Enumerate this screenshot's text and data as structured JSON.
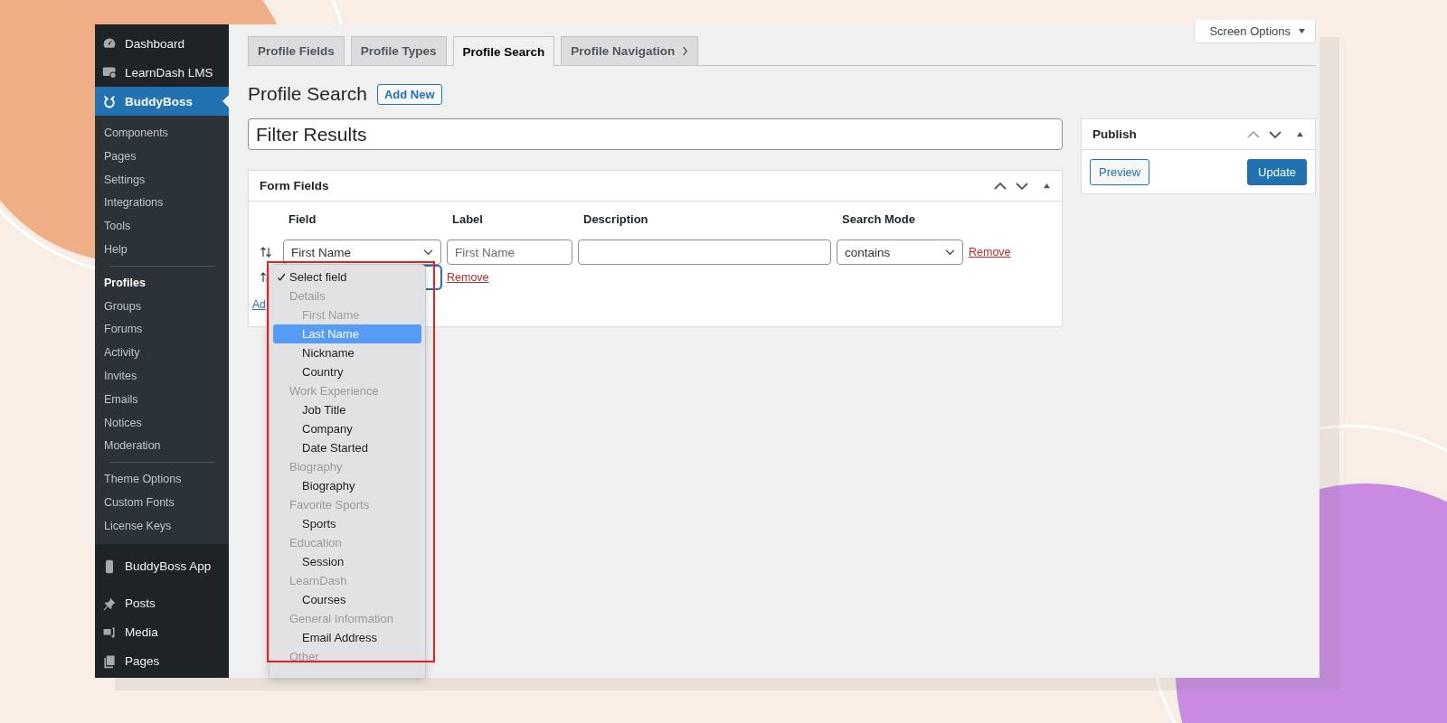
{
  "sidebar": {
    "sections": [
      {
        "items": [
          {
            "label": "Dashboard",
            "selected": false
          },
          {
            "label": "LearnDash LMS",
            "selected": false
          },
          {
            "label": "BuddyBoss",
            "selected": true,
            "submenu": [
              {
                "items": [
                  {
                    "label": "Components",
                    "selected": false
                  },
                  {
                    "label": "Pages",
                    "selected": false
                  },
                  {
                    "label": "Settings",
                    "selected": false
                  },
                  {
                    "label": "Integrations",
                    "selected": false
                  },
                  {
                    "label": "Tools",
                    "selected": false
                  },
                  {
                    "label": "Help",
                    "selected": false
                  }
                ]
              },
              {
                "items": [
                  {
                    "label": "Profiles",
                    "selected": true
                  },
                  {
                    "label": "Groups",
                    "selected": false
                  },
                  {
                    "label": "Forums",
                    "selected": false
                  },
                  {
                    "label": "Activity",
                    "selected": false
                  },
                  {
                    "label": "Invites",
                    "selected": false
                  },
                  {
                    "label": "Emails",
                    "selected": false
                  },
                  {
                    "label": "Notices",
                    "selected": false
                  },
                  {
                    "label": "Moderation",
                    "selected": false
                  }
                ]
              },
              {
                "items": [
                  {
                    "label": "Theme Options",
                    "selected": false
                  },
                  {
                    "label": "Custom Fonts",
                    "selected": false
                  },
                  {
                    "label": "License Keys",
                    "selected": false
                  }
                ]
              }
            ]
          }
        ]
      },
      {
        "items": [
          {
            "label": "BuddyBoss App",
            "selected": false
          }
        ]
      },
      {
        "items": [
          {
            "label": "Posts",
            "selected": false
          },
          {
            "label": "Media",
            "selected": false
          },
          {
            "label": "Pages",
            "selected": false
          }
        ]
      }
    ]
  },
  "screen_options": "Screen Options",
  "tabs": [
    {
      "label": "Profile Fields",
      "kind": "tab",
      "selected": false
    },
    {
      "label": "Profile Types",
      "kind": "tab",
      "selected": false
    },
    {
      "label": "Profile Search",
      "kind": "tab",
      "selected": true
    },
    {
      "label": "Profile Navigation",
      "kind": "menu",
      "selected": false
    }
  ],
  "heading": "Profile Search",
  "add_new": "Add New",
  "title_value": "Filter Results",
  "form_fields": {
    "title": "Form Fields",
    "columns": [
      "Field",
      "Label",
      "Description",
      "Search Mode"
    ],
    "rows": [
      {
        "field": "First Name",
        "label_placeholder": "First Name",
        "search_mode": "contains",
        "remove": "Remove"
      },
      {
        "field_focused": true,
        "remove": "Remove"
      }
    ],
    "add_link": "Ad"
  },
  "publish": {
    "title": "Publish",
    "preview": "Preview",
    "update": "Update"
  },
  "dropdown": {
    "items": [
      {
        "kind": "option",
        "label": "Select field",
        "checked": true,
        "selected": false,
        "disabled": false
      },
      {
        "kind": "group",
        "label": "Details",
        "children": [
          {
            "label": "First Name",
            "checked": false,
            "selected": false,
            "disabled": true
          },
          {
            "label": "Last Name",
            "checked": false,
            "selected": true,
            "disabled": false
          },
          {
            "label": "Nickname",
            "checked": false,
            "selected": false,
            "disabled": false
          },
          {
            "label": "Country",
            "checked": false,
            "selected": false,
            "disabled": false
          }
        ]
      },
      {
        "kind": "group",
        "label": "Work Experience",
        "children": [
          {
            "label": "Job Title",
            "checked": false,
            "selected": false,
            "disabled": false
          },
          {
            "label": "Company",
            "checked": false,
            "selected": false,
            "disabled": false
          },
          {
            "label": "Date Started",
            "checked": false,
            "selected": false,
            "disabled": false
          }
        ]
      },
      {
        "kind": "group",
        "label": "Biography",
        "children": [
          {
            "label": "Biography",
            "checked": false,
            "selected": false,
            "disabled": false
          }
        ]
      },
      {
        "kind": "group",
        "label": "Favorite Sports",
        "children": [
          {
            "label": "Sports",
            "checked": false,
            "selected": false,
            "disabled": false
          }
        ]
      },
      {
        "kind": "group",
        "label": "Education",
        "children": [
          {
            "label": "Session",
            "checked": false,
            "selected": false,
            "disabled": false
          }
        ]
      },
      {
        "kind": "group",
        "label": "LearnDash",
        "children": [
          {
            "label": "Courses",
            "checked": false,
            "selected": false,
            "disabled": false
          }
        ]
      },
      {
        "kind": "group",
        "label": "General Information",
        "children": [
          {
            "label": "Email Address",
            "checked": false,
            "selected": false,
            "disabled": false
          }
        ]
      },
      {
        "kind": "group",
        "label": "Other"
      }
    ],
    "highlighted": true
  }
}
